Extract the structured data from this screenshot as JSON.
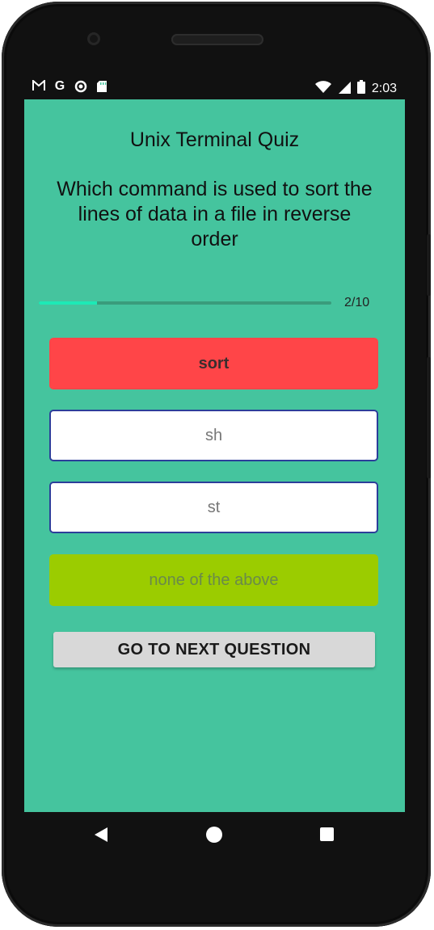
{
  "status_bar": {
    "left_icons": [
      "gmail-icon",
      "google-icon",
      "circle-app-icon",
      "sd-card-icon"
    ],
    "right_icons": [
      "wifi-icon",
      "cell-signal-icon",
      "battery-icon"
    ],
    "time": "2:03"
  },
  "app": {
    "title": "Unix Terminal Quiz",
    "question": "Which command is used to sort the lines of data in a file in reverse order",
    "progress": {
      "count_label": "2/10",
      "fraction": 0.2
    },
    "answers": [
      {
        "label": "sort"
      },
      {
        "label": "sh"
      },
      {
        "label": "st"
      },
      {
        "label": "none of the above"
      }
    ],
    "next_button": "GO TO NEXT QUESTION"
  },
  "colors": {
    "screen_bg": "#45C49E",
    "answer_selected_wrong": "#FF4548",
    "answer_default": "#FFFFFF",
    "answer_highlight": "#9BCC00",
    "progress_fill": "#1DE9B6"
  },
  "nav_bar": {
    "icons": [
      "back-icon",
      "home-icon",
      "recents-icon"
    ]
  }
}
